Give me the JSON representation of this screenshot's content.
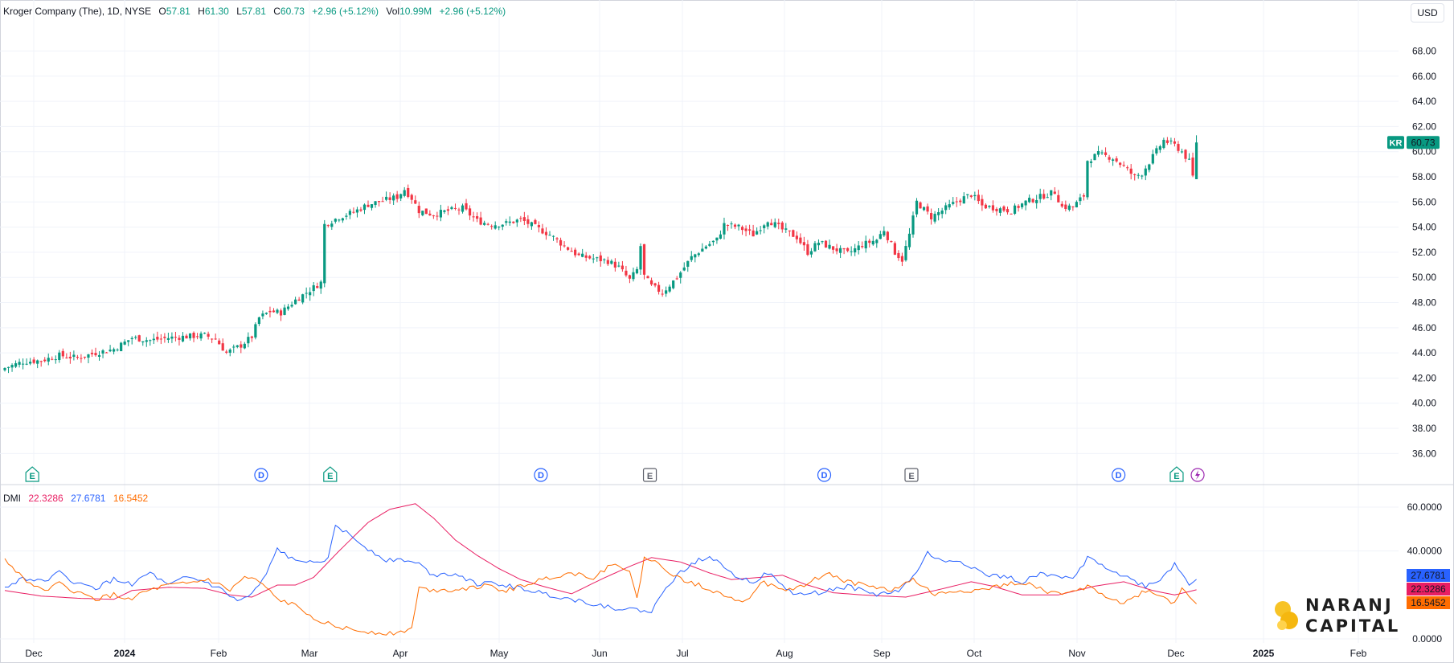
{
  "header": {
    "symbol_title": "Kroger Company (The), 1D, NYSE",
    "open_label": "O",
    "open_value": "57.81",
    "high_label": "H",
    "high_value": "61.30",
    "low_label": "L",
    "low_value": "57.81",
    "close_label": "C",
    "close_value": "60.73",
    "change": "+2.96 (+5.12%)",
    "volume_label": "Vol",
    "volume_value": "10.99M",
    "volume_change": "+2.96 (+5.12%)"
  },
  "currency": "USD",
  "price_label": {
    "ticker": "KR",
    "value": "60.73"
  },
  "dmi": {
    "title": "DMI",
    "adx": "22.3286",
    "plus_di": "27.6781",
    "minus_di": "16.5452"
  },
  "colors": {
    "up": "#089981",
    "down": "#f23645",
    "adx": "#e91e63",
    "plus_di": "#2962ff",
    "minus_di": "#ff6d00",
    "grid": "#f0f3fa",
    "border": "#d1d4dc",
    "dividend": "#2962ff",
    "earnings": "#089981",
    "earnings_past": "#5d606b",
    "split": "#9c27b0"
  },
  "brand": {
    "line1": "NARANJ",
    "line2": "CAPITAL"
  },
  "chart_data": [
    {
      "type": "candlestick",
      "title": "Kroger Company (The), 1D, NYSE",
      "x_ticks": [
        "Dec",
        "2024",
        "Feb",
        "Mar",
        "Apr",
        "May",
        "Jun",
        "Jul",
        "Aug",
        "Sep",
        "Oct",
        "Nov",
        "Dec",
        "2025",
        "Feb"
      ],
      "y_ticks": [
        "68.00",
        "66.00",
        "64.00",
        "62.00",
        "60.00",
        "58.00",
        "56.00",
        "54.00",
        "52.00",
        "50.00",
        "48.00",
        "46.00",
        "44.00",
        "42.00",
        "40.00",
        "38.00",
        "36.00"
      ],
      "ylim": [
        35,
        69.5
      ],
      "anchors_close": [
        [
          0,
          42.8
        ],
        [
          5,
          43.3
        ],
        [
          10,
          43.4
        ],
        [
          15,
          43.8
        ],
        [
          20,
          43.6
        ],
        [
          25,
          44.0
        ],
        [
          30,
          44.3
        ],
        [
          35,
          45.2
        ],
        [
          40,
          45.0
        ],
        [
          45,
          45.2
        ],
        [
          50,
          45.3
        ],
        [
          55,
          45.4
        ],
        [
          58,
          45.1
        ],
        [
          61,
          44.0
        ],
        [
          65,
          44.6
        ],
        [
          68,
          45.3
        ],
        [
          70,
          46.8
        ],
        [
          73,
          47.3
        ],
        [
          76,
          47.2
        ],
        [
          80,
          48.2
        ],
        [
          84,
          49.0
        ],
        [
          87,
          49.6
        ],
        [
          88,
          54.2
        ],
        [
          92,
          54.8
        ],
        [
          96,
          55.2
        ],
        [
          100,
          55.8
        ],
        [
          104,
          56.1
        ],
        [
          108,
          56.4
        ],
        [
          110,
          57.0
        ],
        [
          112,
          56.3
        ],
        [
          114,
          55.3
        ],
        [
          118,
          55.0
        ],
        [
          122,
          55.3
        ],
        [
          126,
          55.5
        ],
        [
          130,
          54.5
        ],
        [
          134,
          54.2
        ],
        [
          138,
          54.3
        ],
        [
          142,
          54.6
        ],
        [
          146,
          54.0
        ],
        [
          150,
          53.4
        ],
        [
          154,
          52.5
        ],
        [
          158,
          51.7
        ],
        [
          162,
          51.5
        ],
        [
          166,
          51.3
        ],
        [
          169,
          50.8
        ],
        [
          172,
          49.8
        ],
        [
          174,
          50.6
        ],
        [
          175,
          52.5
        ],
        [
          176,
          50.1
        ],
        [
          178,
          49.3
        ],
        [
          181,
          48.8
        ],
        [
          185,
          50.0
        ],
        [
          189,
          51.6
        ],
        [
          193,
          52.5
        ],
        [
          196,
          53.0
        ],
        [
          198,
          54.2
        ],
        [
          202,
          54.0
        ],
        [
          206,
          53.4
        ],
        [
          210,
          54.6
        ],
        [
          214,
          53.8
        ],
        [
          218,
          53.2
        ],
        [
          221,
          52.0
        ],
        [
          224,
          52.8
        ],
        [
          228,
          52.3
        ],
        [
          232,
          51.9
        ],
        [
          236,
          52.6
        ],
        [
          240,
          53.0
        ],
        [
          242,
          53.8
        ],
        [
          245,
          52.0
        ],
        [
          247,
          51.4
        ],
        [
          249,
          53.4
        ],
        [
          251,
          56.0
        ],
        [
          255,
          54.8
        ],
        [
          259,
          55.5
        ],
        [
          263,
          56.2
        ],
        [
          266,
          56.6
        ],
        [
          269,
          55.7
        ],
        [
          273,
          55.5
        ],
        [
          277,
          55.3
        ],
        [
          281,
          56.0
        ],
        [
          285,
          56.4
        ],
        [
          289,
          56.8
        ],
        [
          291,
          55.6
        ],
        [
          294,
          55.6
        ],
        [
          297,
          56.5
        ],
        [
          298,
          59.3
        ],
        [
          301,
          59.8
        ],
        [
          305,
          59.5
        ],
        [
          308,
          58.8
        ],
        [
          311,
          58.0
        ],
        [
          313,
          58.3
        ],
        [
          316,
          59.6
        ],
        [
          319,
          60.9
        ],
        [
          322,
          60.5
        ],
        [
          324,
          60.0
        ],
        [
          326,
          59.2
        ],
        [
          327,
          58.0
        ],
        [
          328,
          60.73
        ]
      ],
      "ohlc_last": {
        "open": 57.81,
        "high": 61.3,
        "low": 57.81,
        "close": 60.73
      },
      "event_markers": [
        {
          "type": "E",
          "day": 8,
          "state": "past"
        },
        {
          "type": "D",
          "day": 71,
          "state": "past"
        },
        {
          "type": "E",
          "day": 90,
          "state": "past"
        },
        {
          "type": "D",
          "day": 148,
          "state": "past"
        },
        {
          "type": "E",
          "day": 178,
          "state": "past-grey"
        },
        {
          "type": "D",
          "day": 226,
          "state": "past"
        },
        {
          "type": "E",
          "day": 250,
          "state": "past-grey"
        },
        {
          "type": "D",
          "day": 307,
          "state": "past"
        },
        {
          "type": "E",
          "day": 323,
          "state": "past"
        },
        {
          "type": "S",
          "day": 327,
          "state": "split"
        }
      ]
    },
    {
      "type": "line",
      "title": "DMI",
      "y_ticks": [
        "60.0000",
        "40.0000",
        "0.0000"
      ],
      "ylim": [
        0,
        64
      ],
      "series": [
        {
          "name": "ADX",
          "anchors": [
            [
              0,
              22
            ],
            [
              10,
              19.5
            ],
            [
              20,
              18.5
            ],
            [
              30,
              18.0
            ],
            [
              35,
              22
            ],
            [
              45,
              23.5
            ],
            [
              55,
              23
            ],
            [
              62,
              20
            ],
            [
              68,
              19
            ],
            [
              75,
              24.5
            ],
            [
              80,
              24.5
            ],
            [
              85,
              28
            ],
            [
              92,
              40
            ],
            [
              100,
              53
            ],
            [
              106,
              59
            ],
            [
              113,
              61.5
            ],
            [
              118,
              55
            ],
            [
              124,
              45
            ],
            [
              130,
              38
            ],
            [
              136,
              32
            ],
            [
              142,
              27
            ],
            [
              148,
              24
            ],
            [
              156,
              20.5
            ],
            [
              164,
              27
            ],
            [
              172,
              33
            ],
            [
              178,
              37
            ],
            [
              186,
              35
            ],
            [
              194,
              30
            ],
            [
              200,
              27
            ],
            [
              208,
              28
            ],
            [
              214,
              29
            ],
            [
              220,
              25
            ],
            [
              228,
              21
            ],
            [
              236,
              20
            ],
            [
              248,
              19
            ],
            [
              256,
              22
            ],
            [
              266,
              26
            ],
            [
              272,
              24
            ],
            [
              280,
              20
            ],
            [
              290,
              20
            ],
            [
              300,
              24
            ],
            [
              308,
              26
            ],
            [
              316,
              22
            ],
            [
              322,
              20
            ],
            [
              328,
              22.33
            ]
          ]
        },
        {
          "name": "+DI",
          "anchors": [
            [
              0,
              23
            ],
            [
              5,
              28
            ],
            [
              10,
              26
            ],
            [
              15,
              30
            ],
            [
              20,
              25
            ],
            [
              25,
              23
            ],
            [
              30,
              27
            ],
            [
              35,
              25
            ],
            [
              40,
              30
            ],
            [
              45,
              24
            ],
            [
              50,
              28
            ],
            [
              55,
              26
            ],
            [
              60,
              22
            ],
            [
              64,
              17
            ],
            [
              68,
              20
            ],
            [
              72,
              29
            ],
            [
              75,
              41
            ],
            [
              80,
              35
            ],
            [
              85,
              36
            ],
            [
              89,
              36
            ],
            [
              91,
              52
            ],
            [
              95,
              47
            ],
            [
              100,
              41
            ],
            [
              105,
              36
            ],
            [
              110,
              36
            ],
            [
              114,
              34
            ],
            [
              118,
              29
            ],
            [
              124,
              30
            ],
            [
              130,
              25
            ],
            [
              136,
              25
            ],
            [
              142,
              23
            ],
            [
              150,
              20
            ],
            [
              156,
              18
            ],
            [
              162,
              16
            ],
            [
              168,
              14
            ],
            [
              175,
              13
            ],
            [
              178,
              12
            ],
            [
              182,
              24
            ],
            [
              186,
              30
            ],
            [
              190,
              35
            ],
            [
              194,
              38
            ],
            [
              198,
              33
            ],
            [
              202,
              28
            ],
            [
              206,
              26
            ],
            [
              210,
              30
            ],
            [
              214,
              24
            ],
            [
              218,
              20
            ],
            [
              224,
              21
            ],
            [
              232,
              24
            ],
            [
              240,
              20
            ],
            [
              246,
              22
            ],
            [
              250,
              28
            ],
            [
              254,
              39
            ],
            [
              258,
              35
            ],
            [
              262,
              36
            ],
            [
              266,
              33
            ],
            [
              270,
              29
            ],
            [
              276,
              28
            ],
            [
              280,
              26
            ],
            [
              286,
              30
            ],
            [
              290,
              28
            ],
            [
              294,
              27
            ],
            [
              298,
              37
            ],
            [
              302,
              34
            ],
            [
              306,
              30
            ],
            [
              310,
              27
            ],
            [
              314,
              24
            ],
            [
              318,
              27
            ],
            [
              322,
              34
            ],
            [
              326,
              25
            ],
            [
              328,
              27.68
            ]
          ]
        },
        {
          "name": "-DI",
          "anchors": [
            [
              0,
              36
            ],
            [
              5,
              28
            ],
            [
              10,
              22
            ],
            [
              15,
              25
            ],
            [
              20,
              21
            ],
            [
              25,
              18
            ],
            [
              30,
              20
            ],
            [
              34,
              18
            ],
            [
              38,
              21
            ],
            [
              44,
              24
            ],
            [
              50,
              25
            ],
            [
              56,
              27
            ],
            [
              62,
              22
            ],
            [
              66,
              28
            ],
            [
              70,
              26
            ],
            [
              75,
              18
            ],
            [
              80,
              15
            ],
            [
              85,
              10
            ],
            [
              90,
              6
            ],
            [
              96,
              4
            ],
            [
              102,
              3
            ],
            [
              108,
              2.5
            ],
            [
              112,
              5
            ],
            [
              114,
              23
            ],
            [
              120,
              22
            ],
            [
              126,
              23
            ],
            [
              132,
              24
            ],
            [
              138,
              22
            ],
            [
              144,
              25
            ],
            [
              150,
              28
            ],
            [
              156,
              30
            ],
            [
              162,
              28
            ],
            [
              168,
              35
            ],
            [
              172,
              30
            ],
            [
              174,
              18
            ],
            [
              176,
              37
            ],
            [
              180,
              34
            ],
            [
              186,
              27
            ],
            [
              192,
              24
            ],
            [
              198,
              20
            ],
            [
              204,
              17
            ],
            [
              208,
              26
            ],
            [
              214,
              22
            ],
            [
              220,
              24
            ],
            [
              226,
              30
            ],
            [
              232,
              26
            ],
            [
              238,
              24
            ],
            [
              244,
              22
            ],
            [
              250,
              27
            ],
            [
              256,
              20
            ],
            [
              262,
              22
            ],
            [
              268,
              22
            ],
            [
              274,
              24
            ],
            [
              280,
              26
            ],
            [
              286,
              22
            ],
            [
              292,
              20
            ],
            [
              298,
              24
            ],
            [
              304,
              19
            ],
            [
              308,
              16
            ],
            [
              314,
              22
            ],
            [
              318,
              20
            ],
            [
              322,
              16
            ],
            [
              324,
              23
            ],
            [
              328,
              16.55
            ]
          ]
        }
      ]
    }
  ]
}
